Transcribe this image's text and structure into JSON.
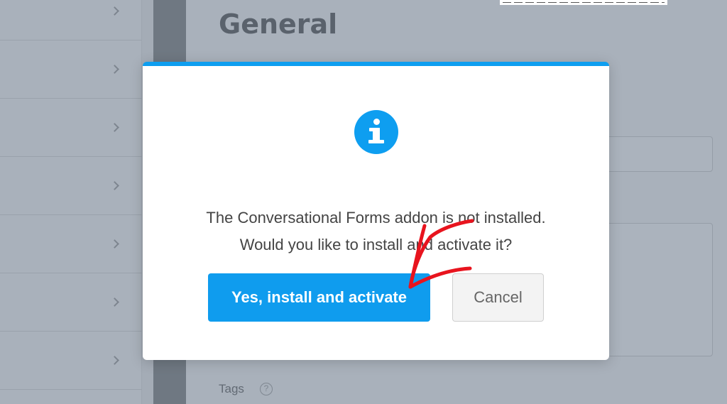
{
  "background": {
    "page_title": "General",
    "tags_label": "Tags",
    "help_icon": "question-circle-icon",
    "chevron_icon": "chevron-right-icon"
  },
  "modal": {
    "icon": "info-circle-icon",
    "message_line1": "The Conversational Forms addon is not installed.",
    "message_line2": "Would you like to install and activate it?",
    "confirm_label": "Yes, install and activate",
    "cancel_label": "Cancel",
    "accent_color": "#0e9ef0"
  },
  "annotation": {
    "arrow_color": "#e8141e",
    "arrow_icon": "hand-drawn-arrow-icon"
  }
}
